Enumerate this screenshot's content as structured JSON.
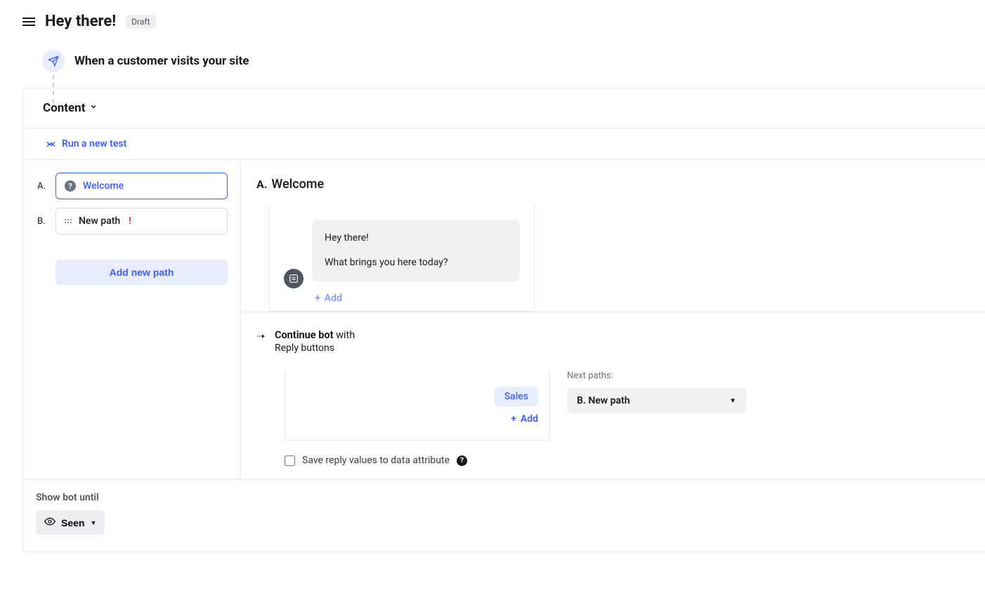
{
  "header": {
    "title": "Hey there!",
    "status_badge": "Draft"
  },
  "trigger": {
    "label": "When a customer visits your site"
  },
  "content": {
    "heading": "Content",
    "run_test_label": "Run a new test",
    "paths": [
      {
        "letter": "A.",
        "name": "Welcome",
        "active": true
      },
      {
        "letter": "B.",
        "name": "New path",
        "active": false,
        "has_warning": true
      }
    ],
    "add_path_label": "Add new path"
  },
  "selected_path": {
    "letter": "A.",
    "name": "Welcome",
    "messages": {
      "line1": "Hey there!",
      "line2": "What brings you here today?"
    },
    "add_label": "Add"
  },
  "continue_bot": {
    "title_bold": "Continue bot",
    "title_rest": " with",
    "subtitle": "Reply buttons",
    "reply_chip": "Sales",
    "add_label": "Add",
    "next_paths_label": "Next paths:",
    "next_path_selected": "B. New path",
    "save_reply_label": "Save reply values to data attribute"
  },
  "footer": {
    "show_bot_label": "Show bot until",
    "seen_label": "Seen"
  }
}
